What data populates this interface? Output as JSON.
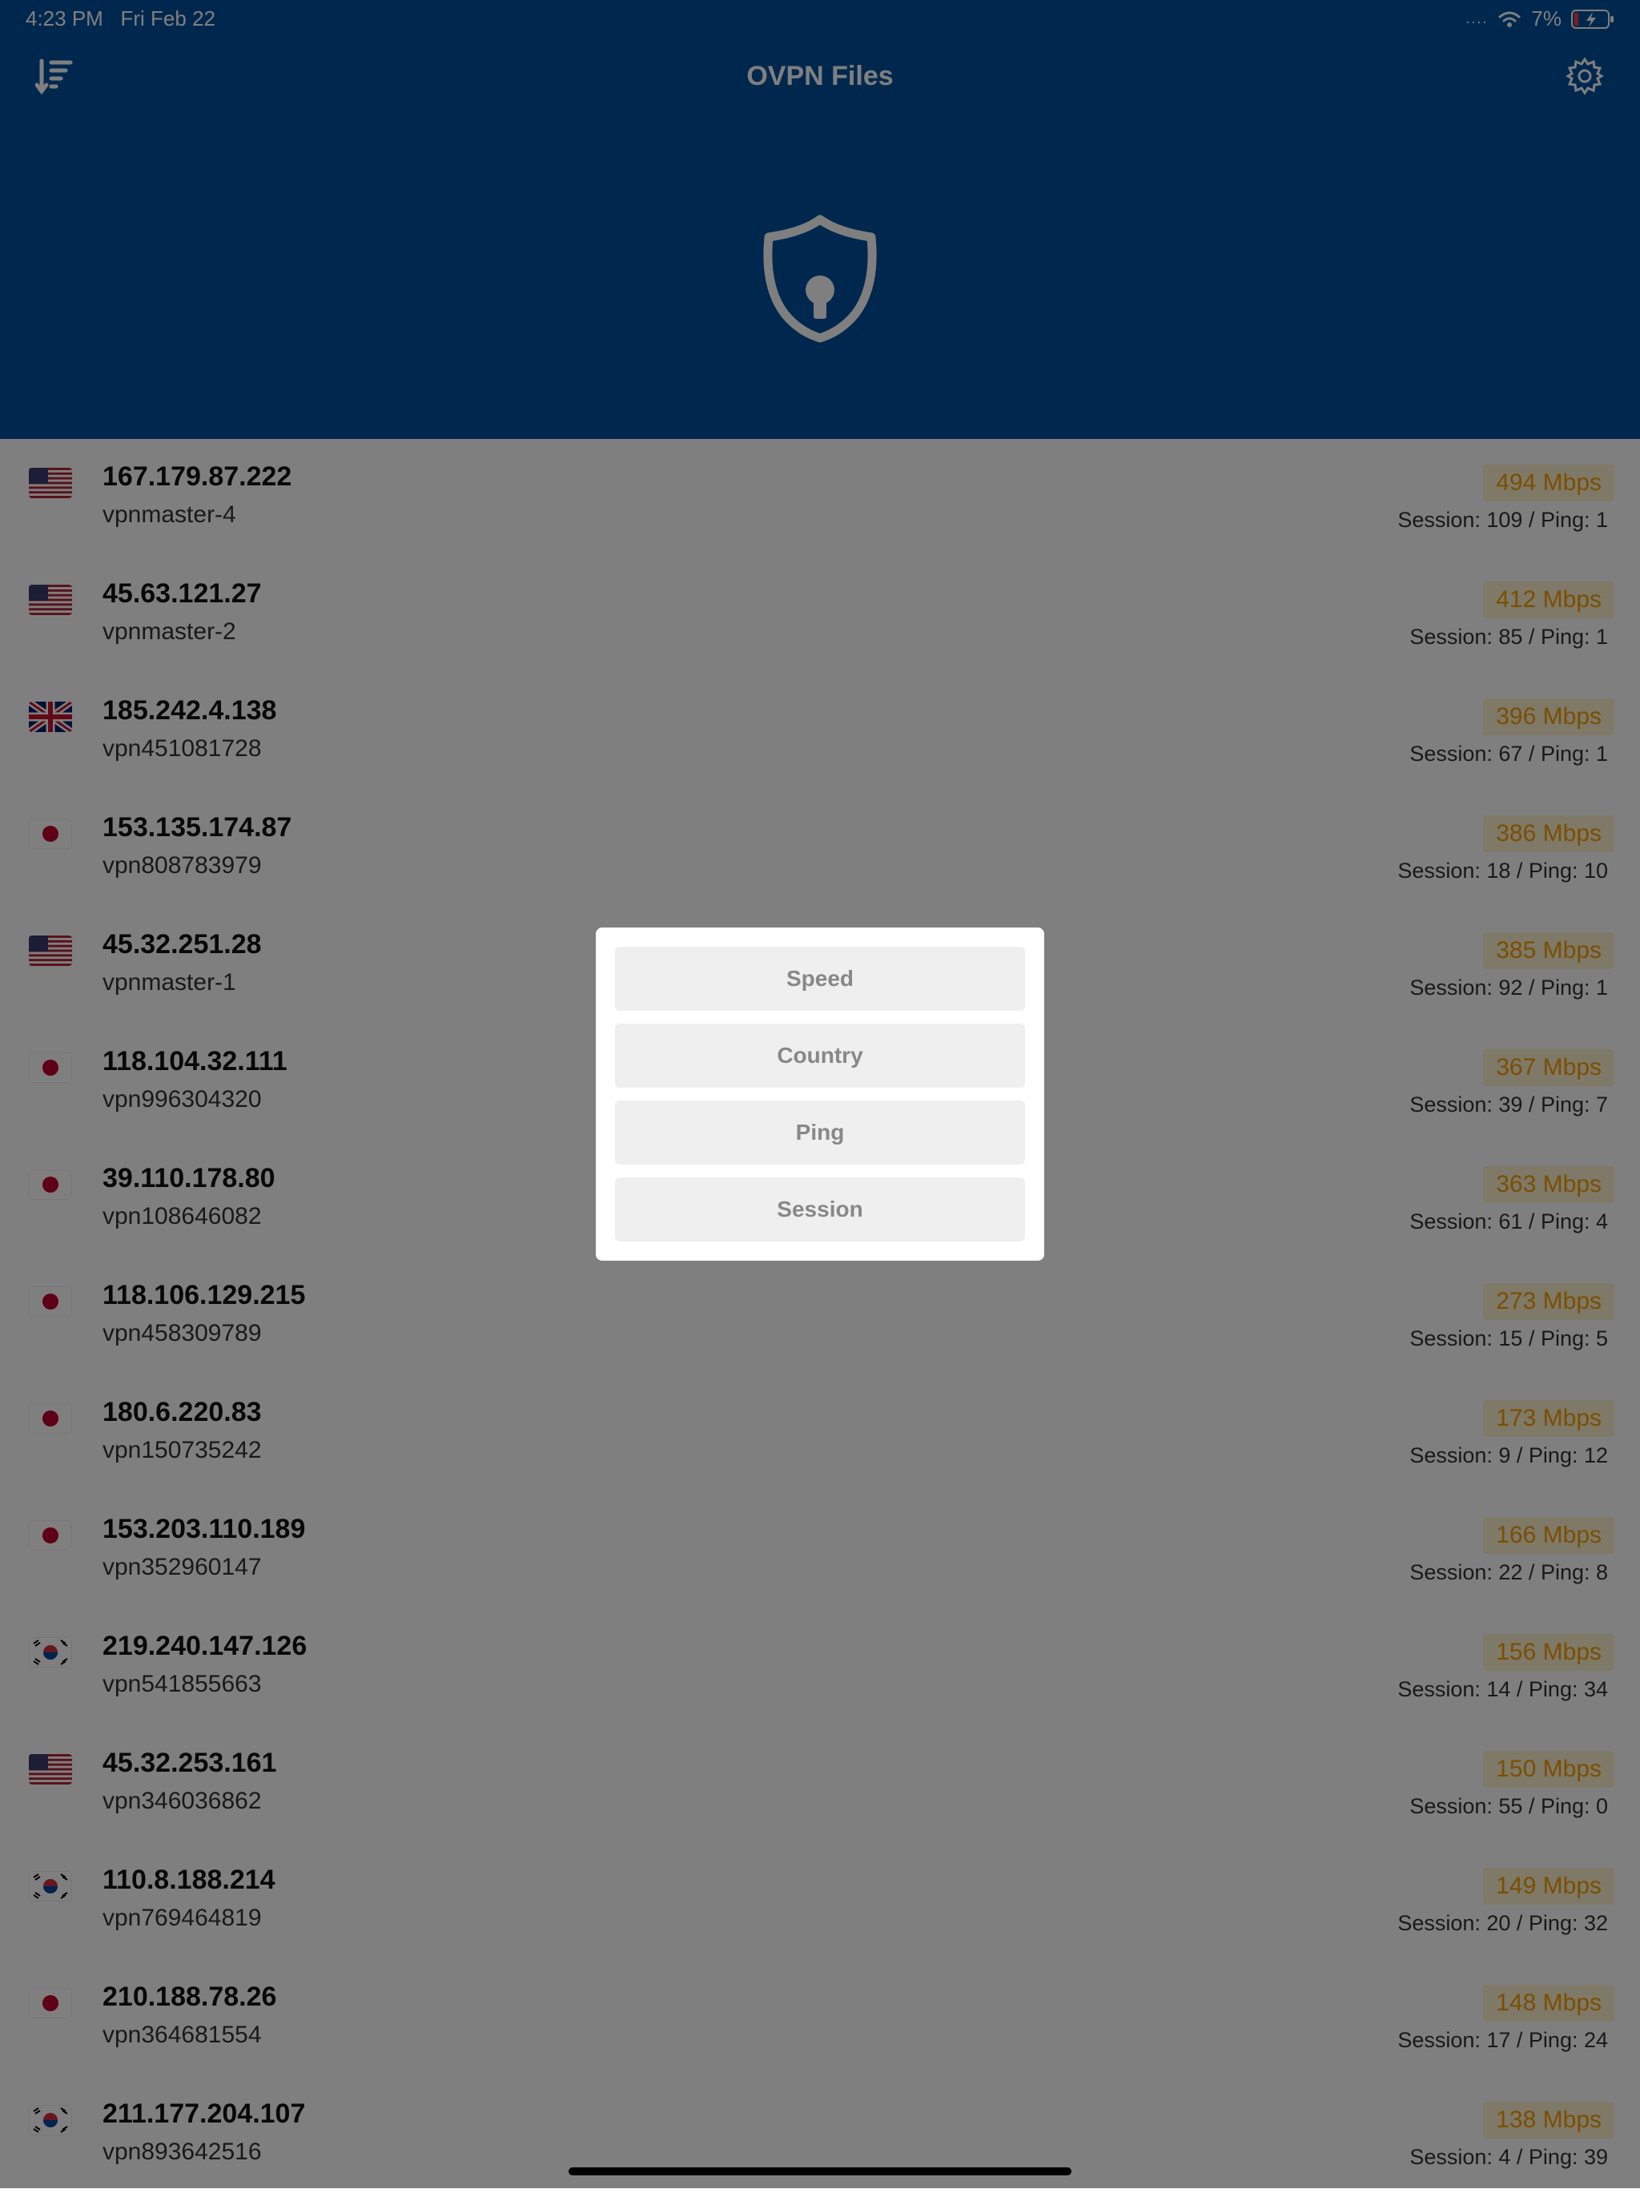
{
  "status": {
    "time": "4:23 PM",
    "date": "Fri Feb 22",
    "battery": "7%"
  },
  "header": {
    "title": "OVPN Files",
    "sort_icon": "sort-descending-icon",
    "settings_icon": "gear-icon",
    "logo_icon": "shield-lock-icon"
  },
  "servers": [
    {
      "flag": "us",
      "ip": "167.179.87.222",
      "host": "vpnmaster-4",
      "speed": "494 Mbps",
      "meta": "Session: 109 / Ping: 1"
    },
    {
      "flag": "us",
      "ip": "45.63.121.27",
      "host": "vpnmaster-2",
      "speed": "412 Mbps",
      "meta": "Session: 85 / Ping: 1"
    },
    {
      "flag": "uk",
      "ip": "185.242.4.138",
      "host": "vpn451081728",
      "speed": "396 Mbps",
      "meta": "Session: 67 / Ping: 1"
    },
    {
      "flag": "jp",
      "ip": "153.135.174.87",
      "host": "vpn808783979",
      "speed": "386 Mbps",
      "meta": "Session: 18 / Ping: 10"
    },
    {
      "flag": "us",
      "ip": "45.32.251.28",
      "host": "vpnmaster-1",
      "speed": "385 Mbps",
      "meta": "Session: 92 / Ping: 1"
    },
    {
      "flag": "jp",
      "ip": "118.104.32.111",
      "host": "vpn996304320",
      "speed": "367 Mbps",
      "meta": "Session: 39 / Ping: 7"
    },
    {
      "flag": "jp",
      "ip": "39.110.178.80",
      "host": "vpn108646082",
      "speed": "363 Mbps",
      "meta": "Session: 61 / Ping: 4"
    },
    {
      "flag": "jp",
      "ip": "118.106.129.215",
      "host": "vpn458309789",
      "speed": "273 Mbps",
      "meta": "Session: 15 / Ping: 5"
    },
    {
      "flag": "jp",
      "ip": "180.6.220.83",
      "host": "vpn150735242",
      "speed": "173 Mbps",
      "meta": "Session: 9 / Ping: 12"
    },
    {
      "flag": "jp",
      "ip": "153.203.110.189",
      "host": "vpn352960147",
      "speed": "166 Mbps",
      "meta": "Session: 22 / Ping: 8"
    },
    {
      "flag": "kr",
      "ip": "219.240.147.126",
      "host": "vpn541855663",
      "speed": "156 Mbps",
      "meta": "Session: 14 / Ping: 34"
    },
    {
      "flag": "us",
      "ip": "45.32.253.161",
      "host": "vpn346036862",
      "speed": "150 Mbps",
      "meta": "Session: 55 / Ping: 0"
    },
    {
      "flag": "kr",
      "ip": "110.8.188.214",
      "host": "vpn769464819",
      "speed": "149 Mbps",
      "meta": "Session: 20 / Ping: 32"
    },
    {
      "flag": "jp",
      "ip": "210.188.78.26",
      "host": "vpn364681554",
      "speed": "148 Mbps",
      "meta": "Session: 17 / Ping: 24"
    },
    {
      "flag": "kr",
      "ip": "211.177.204.107",
      "host": "vpn893642516",
      "speed": "138 Mbps",
      "meta": "Session: 4 / Ping: 39"
    }
  ],
  "sort_menu": {
    "options": [
      "Speed",
      "Country",
      "Ping",
      "Session"
    ]
  }
}
